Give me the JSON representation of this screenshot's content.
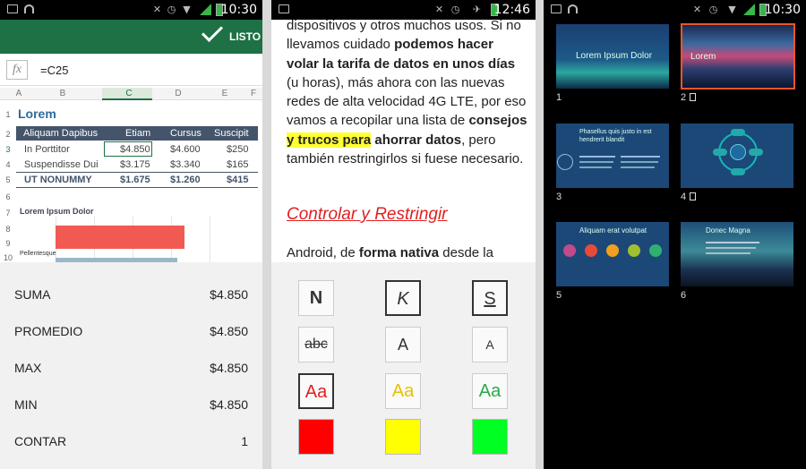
{
  "excel": {
    "time": "10:30",
    "done_label": "LISTO",
    "fx_label": "fx",
    "formula": "=C25",
    "columns": [
      "A",
      "B",
      "C",
      "D",
      "E",
      "F"
    ],
    "rows": [
      "1",
      "2",
      "3",
      "4",
      "5",
      "6",
      "7",
      "8",
      "9",
      "10"
    ],
    "sheet_title": "Lorem",
    "table_header": [
      "Aliquam Dapibus",
      "Etiam",
      "Cursus",
      "Suscipit"
    ],
    "table_rows": [
      [
        "In Porttitor",
        "$4.850",
        "$4.600",
        "$250"
      ],
      [
        "Suspendisse Dui",
        "$3.175",
        "$3.340",
        "$165"
      ],
      [
        "UT NONUMMY",
        "$1.675",
        "$1.260",
        "$415"
      ]
    ],
    "chart_title": "Lorem Ipsum Dolor",
    "chart_label": "Pellentesque",
    "stats": [
      {
        "label": "SUMA",
        "value": "$4.850"
      },
      {
        "label": "PROMEDIO",
        "value": "$4.850"
      },
      {
        "label": "MAX",
        "value": "$4.850"
      },
      {
        "label": "MIN",
        "value": "$4.850"
      },
      {
        "label": "CONTAR",
        "value": "1"
      }
    ]
  },
  "word": {
    "time": "12:46",
    "p1": "dispositivos y otros muchos usos. Si no llevamos cuidado ",
    "b1": "podemos hacer volar la tarifa de datos en unos días",
    "p2": " (u horas), más ahora con las nuevas redes de alta velocidad 4G LTE, por eso vamos a recopilar una lista de ",
    "b2": "consejos",
    "b3": "y trucos para",
    "b4": "ahorrar datos",
    "p3": ", pero también restringirlos si fuese necesario.",
    "heading": "Controlar y Restringir",
    "p4": "Android, de ",
    "b5": "forma nativa",
    "p5": " desde la",
    "format_buttons": [
      "N",
      "K",
      "S",
      "abc",
      "A",
      "A",
      "Aa",
      "Aa",
      "Aa"
    ],
    "colors": {
      "red": "#ff0000",
      "yellow": "#ffff00",
      "green": "#00ff22",
      "accent_text_red": "#e02020",
      "accent_text_yellow": "#e8c000",
      "accent_text_green": "#2ca84a"
    }
  },
  "powerpoint": {
    "time": "10:30",
    "slides": [
      {
        "num": "1",
        "title": "Lorem Ipsum Dolor"
      },
      {
        "num": "2",
        "title": "Lorem"
      },
      {
        "num": "3",
        "title": "Phasellus quis justo in est hendrerit blandit"
      },
      {
        "num": "4",
        "title": ""
      },
      {
        "num": "5",
        "title": "Aliquam erat volutpat"
      },
      {
        "num": "6",
        "title": "Donec Magna"
      }
    ]
  }
}
